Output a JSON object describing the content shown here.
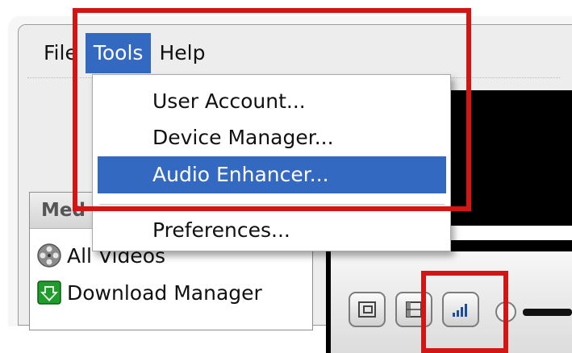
{
  "menubar": {
    "items": [
      {
        "label": "File"
      },
      {
        "label": "Tools"
      },
      {
        "label": "Help"
      }
    ],
    "active": "Tools"
  },
  "tools_menu": {
    "items": [
      {
        "label": "User Account..."
      },
      {
        "label": "Device Manager..."
      },
      {
        "label": "Audio Enhancer...",
        "highlighted": true
      },
      {
        "label": "Preferences..."
      }
    ]
  },
  "side_panel": {
    "header": "Med",
    "rows": [
      {
        "label": "All Videos",
        "icon": "film-reel-icon"
      },
      {
        "label": "Download Manager",
        "icon": "download-arrow-icon"
      }
    ]
  },
  "player_controls": {
    "buttons": [
      {
        "icon": "popout-window-icon"
      },
      {
        "icon": "filmstrip-icon"
      },
      {
        "icon": "signal-bars-icon"
      }
    ]
  },
  "colors": {
    "highlight": "#3469c1",
    "annotation": "#d21616",
    "download_icon": "#1f9c2a"
  }
}
